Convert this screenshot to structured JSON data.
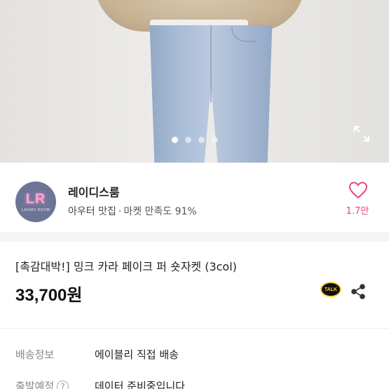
{
  "seller": {
    "avatar_text": "LR",
    "avatar_subtext": "LADIES ROOM",
    "name": "레이디스룸",
    "category": "아우터 맛집",
    "separator": "·",
    "satisfaction": "마켓 만족도 91%",
    "likes": "1.7만"
  },
  "gallery": {
    "total_images": 4,
    "active_index": 0
  },
  "product": {
    "title": "[촉감대박!] 밍크 카라 페이크 퍼 숏자켓 (3col)",
    "price": "33,700원",
    "talk_label": "TALK"
  },
  "info": {
    "shipping_label": "배송정보",
    "shipping_value": "에이블리 직접 배송",
    "departure_label": "출발예정",
    "departure_help": "?",
    "departure_value": "데이터 준비중입니다"
  },
  "colors": {
    "accent_pink": "#e8477e",
    "avatar_bg": "#6d7596",
    "kakao_yellow": "#f7d23a"
  }
}
